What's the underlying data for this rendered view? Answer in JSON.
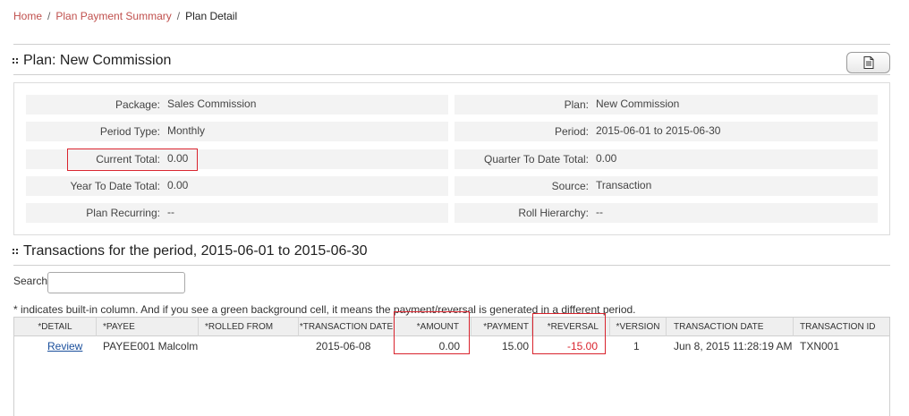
{
  "breadcrumb": {
    "home": "Home",
    "sep": "/",
    "summary": "Plan Payment Summary",
    "current": "Plan Detail"
  },
  "plan": {
    "title": "Plan: New Commission",
    "export_icon": "document-icon",
    "fields": {
      "package_label": "Package:",
      "package_value": "Sales Commission",
      "period_type_label": "Period Type:",
      "period_type_value": "Monthly",
      "current_total_label": "Current Total:",
      "current_total_value": "0.00",
      "ytd_total_label": "Year To Date Total:",
      "ytd_total_value": "0.00",
      "plan_recurring_label": "Plan Recurring:",
      "plan_recurring_value": "--",
      "plan_label": "Plan:",
      "plan_value": "New Commission",
      "period_label": "Period:",
      "period_value": "2015-06-01 to 2015-06-30",
      "qtd_total_label": "Quarter To Date Total:",
      "qtd_total_value": "0.00",
      "source_label": "Source:",
      "source_value": "Transaction",
      "roll_hierarchy_label": "Roll Hierarchy:",
      "roll_hierarchy_value": "--"
    }
  },
  "transactions": {
    "title": "Transactions for the period, 2015-06-01 to 2015-06-30",
    "search_label": "Search:",
    "search_value": "",
    "note": "* indicates built-in column. And if you see a green background cell, it means the payment/reversal is generated in a different period.",
    "columns": {
      "detail": "*DETAIL",
      "payee": "*PAYEE",
      "rolled_from": "*ROLLED FROM",
      "transaction_date": "*TRANSACTION DATE",
      "amount": "*AMOUNT",
      "payment": "*PAYMENT",
      "reversal": "*REVERSAL",
      "version": "*VERSION",
      "transaction_date_2": "TRANSACTION DATE",
      "transaction_id": "TRANSACTION ID"
    },
    "rows": [
      {
        "detail": "Review",
        "payee": "PAYEE001 Malcolm",
        "rolled_from": "",
        "transaction_date": "2015-06-08",
        "amount": "0.00",
        "payment": "15.00",
        "reversal": "-15.00",
        "version": "1",
        "transaction_datetime": "Jun 8, 2015 11:28:19 AM",
        "transaction_id": "TXN001"
      }
    ]
  },
  "colors": {
    "link": "#c0504d",
    "highlight": "#d9232d",
    "negative": "#d9232d"
  }
}
